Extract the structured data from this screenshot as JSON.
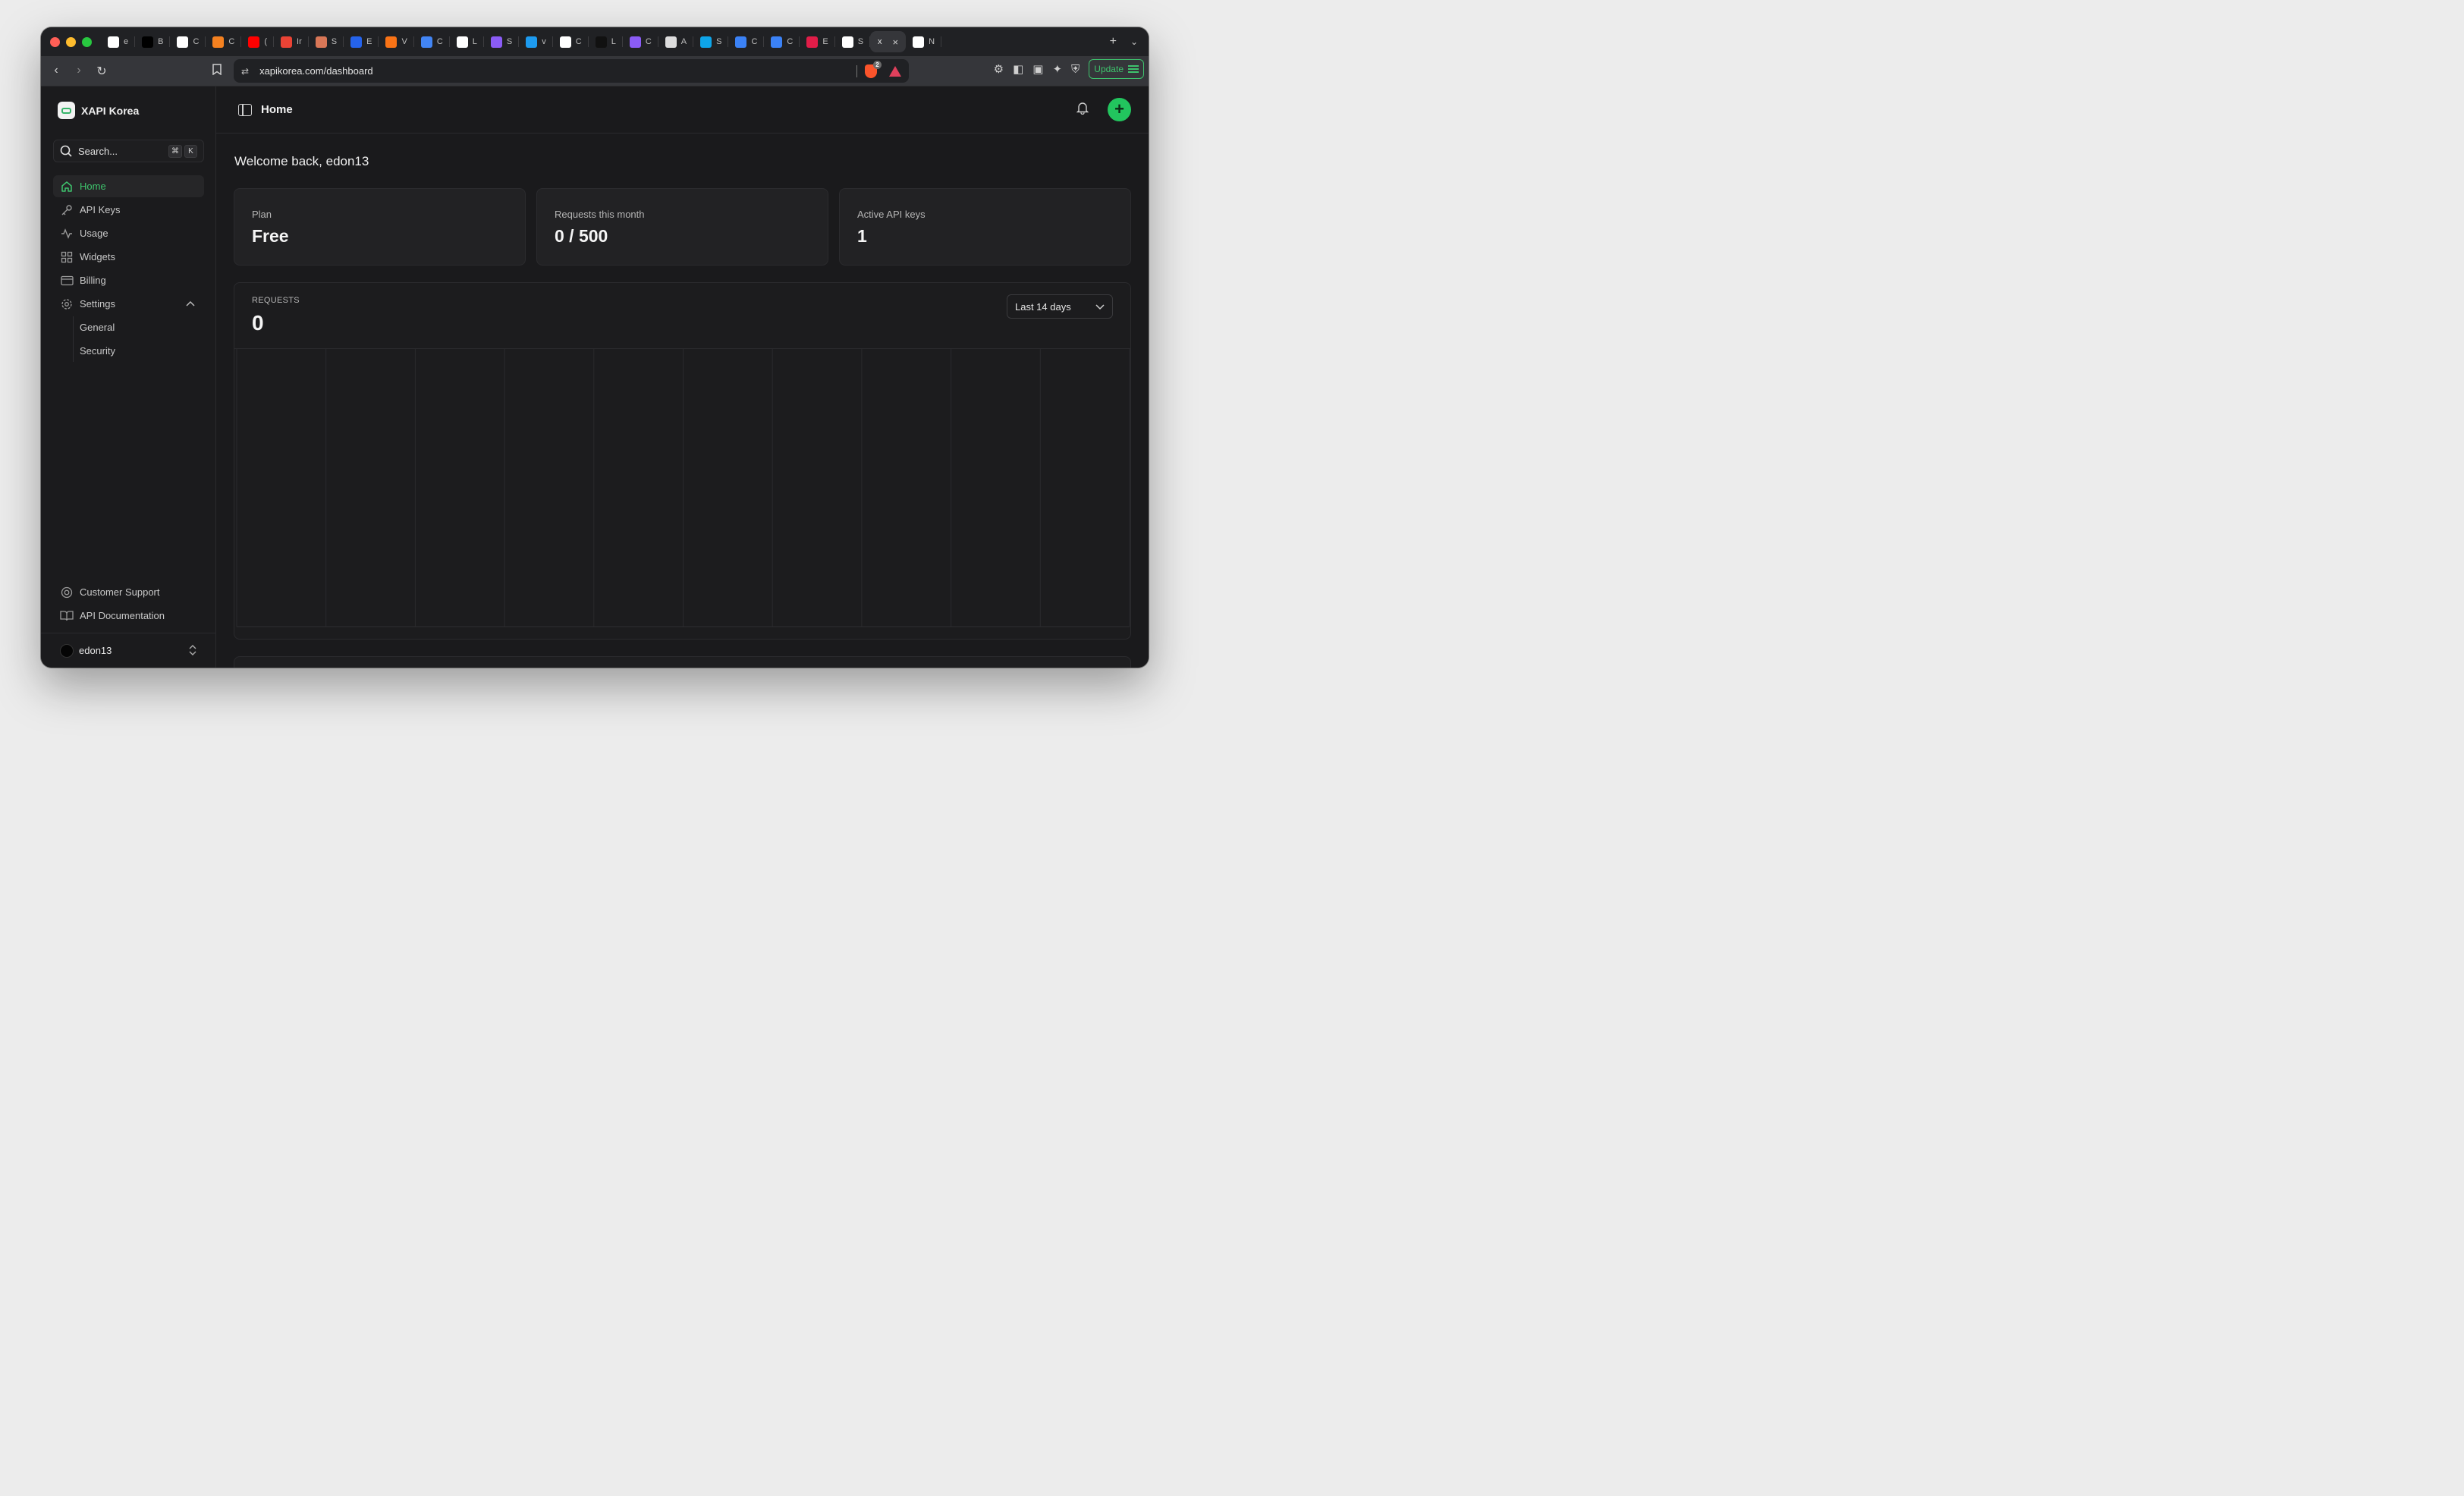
{
  "browser": {
    "tabs": [
      {
        "letter": "e",
        "fav": "github-favicon",
        "color": "#ffffff"
      },
      {
        "letter": "B",
        "fav": "brand-favicon",
        "color": "#000000"
      },
      {
        "letter": "C",
        "fav": "openai-favicon",
        "color": "#ffffff"
      },
      {
        "letter": "C",
        "fav": "cloudflare-favicon",
        "color": "#f48120"
      },
      {
        "letter": "(",
        "fav": "youtube-favicon",
        "color": "#ff0000"
      },
      {
        "letter": "Ir",
        "fav": "gmail-favicon",
        "color": "#ea4335"
      },
      {
        "letter": "S",
        "fav": "claude-favicon",
        "color": "#d97757"
      },
      {
        "letter": "E",
        "fav": "app-favicon",
        "color": "#2563eb"
      },
      {
        "letter": "V",
        "fav": "app-favicon",
        "color": "#f97316"
      },
      {
        "letter": "C",
        "fav": "chart-favicon",
        "color": "#4285f4"
      },
      {
        "letter": "L",
        "fav": "google-favicon",
        "color": "#ffffff"
      },
      {
        "letter": "S",
        "fav": "app-favicon",
        "color": "#8b5cf6"
      },
      {
        "letter": "v",
        "fav": "app-favicon",
        "color": "#1d9bf0"
      },
      {
        "letter": "C",
        "fav": "github-favicon",
        "color": "#ffffff"
      },
      {
        "letter": "L",
        "fav": "app-favicon",
        "color": "#111111"
      },
      {
        "letter": "C",
        "fav": "app-favicon",
        "color": "#8b5cf6"
      },
      {
        "letter": "A",
        "fav": "app-favicon",
        "color": "#dddddd"
      },
      {
        "letter": "S",
        "fav": "app-favicon",
        "color": "#0ea5e9"
      },
      {
        "letter": "C",
        "fav": "shield-favicon",
        "color": "#3b82f6"
      },
      {
        "letter": "C",
        "fav": "app-favicon",
        "color": "#3b82f6"
      },
      {
        "letter": "E",
        "fav": "app-favicon",
        "color": "#e11d48"
      },
      {
        "letter": "S",
        "fav": "app-favicon",
        "color": "#ffffff"
      }
    ],
    "active_tab": {
      "letter": "x",
      "close": "×"
    },
    "last_tab": {
      "letter": "N",
      "fav": "brave-favicon",
      "color": "#ffffff"
    },
    "url": "xapikorea.com/dashboard",
    "shield_badge": "2",
    "update_label": "Update"
  },
  "sidebar": {
    "brand": "XAPI Korea",
    "search_label": "Search...",
    "shortcut": [
      "⌘",
      "K"
    ],
    "nav": [
      {
        "label": "Home",
        "icon": "home-icon",
        "active": true
      },
      {
        "label": "API Keys",
        "icon": "key-icon"
      },
      {
        "label": "Usage",
        "icon": "activity-icon"
      },
      {
        "label": "Widgets",
        "icon": "grid-icon"
      },
      {
        "label": "Billing",
        "icon": "credit-card-icon"
      },
      {
        "label": "Settings",
        "icon": "gear-icon",
        "expanded": true
      }
    ],
    "subnav": [
      "General",
      "Security"
    ],
    "bottom": [
      {
        "label": "Customer Support",
        "icon": "lifebuoy-icon"
      },
      {
        "label": "API Documentation",
        "icon": "book-icon"
      }
    ],
    "user": "edon13"
  },
  "header": {
    "title": "Home"
  },
  "main": {
    "welcome": "Welcome back, edon13",
    "cards": [
      {
        "label": "Plan",
        "value": "Free"
      },
      {
        "label": "Requests this month",
        "value": "0 / 500"
      },
      {
        "label": "Active API keys",
        "value": "1"
      }
    ],
    "requests": {
      "label": "REQUESTS",
      "value": "0",
      "range": "Last 14 days"
    }
  },
  "chart_data": {
    "type": "bar",
    "title": "",
    "xlabel": "",
    "ylabel": "",
    "series": [
      {
        "values": [
          0,
          0,
          0,
          0,
          0,
          0,
          0,
          0,
          0,
          0,
          0,
          0,
          0,
          0
        ]
      }
    ],
    "grid": true
  }
}
